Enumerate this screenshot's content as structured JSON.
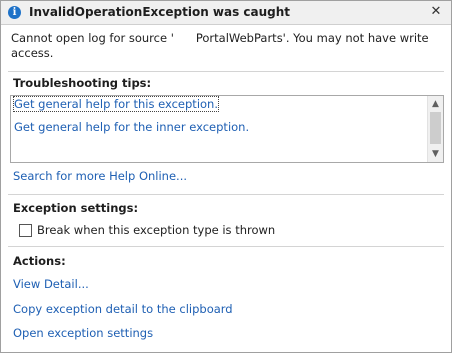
{
  "dialog": {
    "title": "InvalidOperationException was caught",
    "icon": "info-icon",
    "close_glyph": "✕",
    "message_before": "Cannot open log for source '",
    "message_after": "PortalWebParts'. You may not have write access."
  },
  "troubleshooting": {
    "heading": "Troubleshooting tips:",
    "tips": [
      "Get general help for this exception.",
      "Get general help for the inner exception."
    ],
    "search_link": "Search for more Help Online..."
  },
  "exception_settings": {
    "heading": "Exception settings:",
    "break_checkbox_label": "Break when this exception type is thrown",
    "break_checked": false
  },
  "actions": {
    "heading": "Actions:",
    "items": [
      "View Detail...",
      "Copy exception detail to the clipboard",
      "Open exception settings"
    ]
  },
  "colors": {
    "link": "#1e5fb3",
    "icon_blue": "#1e72c8"
  }
}
